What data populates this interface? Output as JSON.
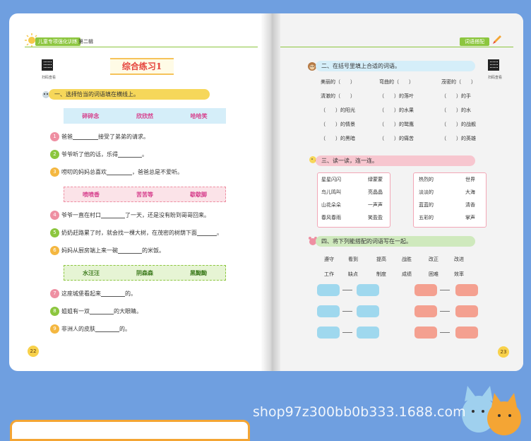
{
  "left": {
    "series_tag": "儿童专项强化训练",
    "series_no": "第二辑",
    "qr_label": "扫码查看",
    "title": "综合练习1",
    "section1": "一、选择恰当的词语填在横线上。",
    "group1": [
      "碎碎念",
      "欣欣然",
      "哈哈笑"
    ],
    "q1": [
      {
        "n": "1",
        "pre": "爸爸",
        "post": "接受了弟弟的请求。"
      },
      {
        "n": "2",
        "pre": "爷爷听了他的话，乐得",
        "post": "。"
      },
      {
        "n": "3",
        "pre": "唠叨的妈妈总喜欢",
        "post": "，爸爸总是不爱听。"
      }
    ],
    "group2": [
      "喷喷香",
      "苦苦等",
      "歇歇脚"
    ],
    "q2": [
      {
        "n": "4",
        "pre": "爷爷一直在村口",
        "post": "了一天，还是没有盼到哥哥回来。"
      },
      {
        "n": "5",
        "pre": "奶奶赶路累了时，就会找一棵大树，在茂密的树荫下面",
        "post": "。"
      },
      {
        "n": "6",
        "pre": "妈妈从厨房端上来一碗",
        "post": "的米饭。"
      }
    ],
    "group3": [
      "水汪汪",
      "阴森森",
      "黑黝黝"
    ],
    "q3": [
      {
        "n": "7",
        "pre": "这座城堡看起来",
        "post": "的。"
      },
      {
        "n": "8",
        "pre": "姐姐有一双",
        "post": "的大眼睛。"
      },
      {
        "n": "9",
        "pre": "非洲人的皮肤",
        "post": "的。"
      }
    ],
    "page_number": "22"
  },
  "right": {
    "tag": "词语搭配",
    "qr_label": "扫码查看",
    "section2": "二、在括号里填上合适的词语。",
    "fill_rows": [
      [
        "美丽的（　　）",
        "弯曲的（　　）",
        "茂密的（　　）"
      ],
      [
        "清澈的（　　）",
        "（　　）的落叶",
        "（　　）的手"
      ],
      [
        "（　　）的阳光",
        "（　　）的水果",
        "（　　）的水"
      ],
      [
        "（　　）的情景",
        "（　　）的鹫鹰",
        "（　　）的战舰"
      ],
      [
        "（　　）的黑暗",
        "（　　）的痛苦",
        "（　　）的英雄"
      ]
    ],
    "section3": "三、读一读，连一连。",
    "match_left": [
      [
        "星星闪闪",
        "绿蒙蒙"
      ],
      [
        "鸟儿鸣叫",
        "亮晶晶"
      ],
      [
        "山花朵朵",
        "一声声"
      ],
      [
        "春风春雨",
        "笑盈盈"
      ]
    ],
    "match_right": [
      [
        "热烈的",
        "世界"
      ],
      [
        "淡淡的",
        "大海"
      ],
      [
        "蓝蓝的",
        "清香"
      ],
      [
        "五彩的",
        "掌声"
      ]
    ],
    "section4": "四、将下列能搭配的词语写在一起。",
    "words_row1": [
      "遵守",
      "看到",
      "提高",
      "战胜",
      "改正",
      "改进"
    ],
    "words_row2": [
      "工作",
      "缺点",
      "制度",
      "成绩",
      "困难",
      "效率"
    ],
    "page_number": "23"
  },
  "watermark": "shop97z300bb0b333.1688.com",
  "colors": {
    "pink": "#ee8fa2",
    "green": "#8cc63e",
    "yellow": "#f6d75a",
    "blue": "#9fd8ee",
    "salmon": "#f4a090",
    "bg": "#6f9fe0"
  }
}
